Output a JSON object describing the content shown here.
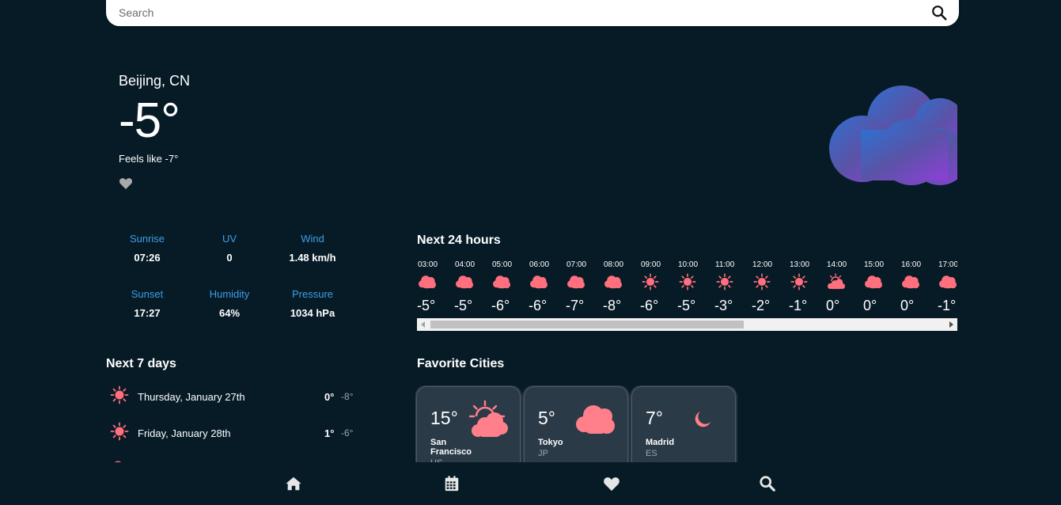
{
  "search": {
    "placeholder": "Search",
    "icon": "search-icon"
  },
  "current": {
    "city": "Beijing, CN",
    "temperature": "-5°",
    "feels_like": "Feels like -7°",
    "favorite_icon": "heart-icon",
    "condition_icon": "cloud-icon"
  },
  "stats": [
    {
      "label": "Sunrise",
      "value": "07:26"
    },
    {
      "label": "UV",
      "value": "0"
    },
    {
      "label": "Wind",
      "value": "1.48 km/h"
    },
    {
      "label": "Sunset",
      "value": "17:27"
    },
    {
      "label": "Humidity",
      "value": "64%"
    },
    {
      "label": "Pressure",
      "value": "1034 hPa"
    }
  ],
  "hourly": {
    "title": "Next 24 hours",
    "hours": [
      {
        "time": "03:00",
        "icon": "cloud",
        "temp": "-5°"
      },
      {
        "time": "04:00",
        "icon": "cloud",
        "temp": "-5°"
      },
      {
        "time": "05:00",
        "icon": "cloud",
        "temp": "-6°"
      },
      {
        "time": "06:00",
        "icon": "cloud",
        "temp": "-6°"
      },
      {
        "time": "07:00",
        "icon": "cloud",
        "temp": "-7°"
      },
      {
        "time": "08:00",
        "icon": "cloud",
        "temp": "-8°"
      },
      {
        "time": "09:00",
        "icon": "sun",
        "temp": "-6°"
      },
      {
        "time": "10:00",
        "icon": "sun",
        "temp": "-5°"
      },
      {
        "time": "11:00",
        "icon": "sun",
        "temp": "-3°"
      },
      {
        "time": "12:00",
        "icon": "sun",
        "temp": "-2°"
      },
      {
        "time": "13:00",
        "icon": "sun",
        "temp": "-1°"
      },
      {
        "time": "14:00",
        "icon": "partly-cloudy",
        "temp": "0°"
      },
      {
        "time": "15:00",
        "icon": "cloud",
        "temp": "0°"
      },
      {
        "time": "16:00",
        "icon": "cloud",
        "temp": "0°"
      },
      {
        "time": "17:00",
        "icon": "cloud",
        "temp": "-1°"
      }
    ]
  },
  "daily": {
    "title": "Next 7 days",
    "days": [
      {
        "name": "Thursday, January 27th",
        "icon": "sun",
        "high": "0°",
        "low": "-8°"
      },
      {
        "name": "Friday, January 28th",
        "icon": "sun",
        "high": "1°",
        "low": "-6°"
      },
      {
        "name": "",
        "icon": "cloud",
        "high": "",
        "low": ""
      }
    ]
  },
  "favorites": {
    "title": "Favorite Cities",
    "cities": [
      {
        "temp": "15°",
        "name": "San Francisco",
        "country": "US",
        "icon": "partly-cloudy"
      },
      {
        "temp": "5°",
        "name": "Tokyo",
        "country": "JP",
        "icon": "cloud"
      },
      {
        "temp": "7°",
        "name": "Madrid",
        "country": "ES",
        "icon": "moon"
      }
    ]
  },
  "nav": [
    {
      "name": "home",
      "icon": "home-icon"
    },
    {
      "name": "calendar",
      "icon": "calendar-icon"
    },
    {
      "name": "favorites",
      "icon": "heart-icon"
    },
    {
      "name": "search",
      "icon": "search-icon"
    }
  ],
  "colors": {
    "background": "#071b26",
    "accent_blue": "#3d9ee8",
    "icon_pink": "#ff6f7d",
    "card_bg": "#2b3a47"
  }
}
